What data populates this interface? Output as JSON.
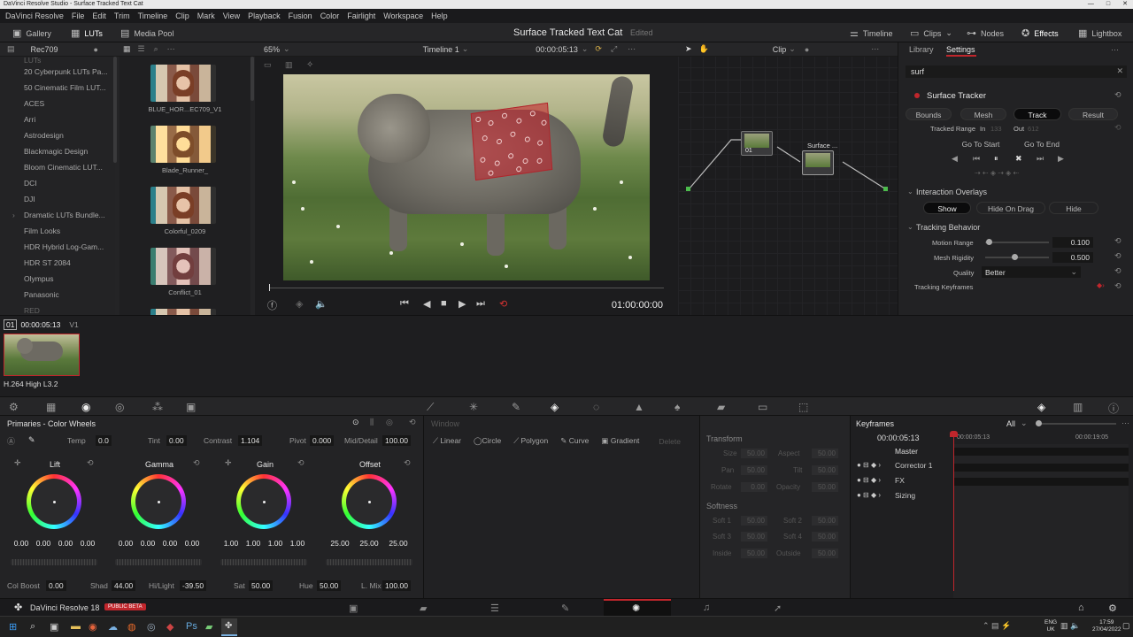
{
  "window_title": "DaVinci Resolve Studio - Surface Tracked Text Cat",
  "menu": [
    "DaVinci Resolve",
    "File",
    "Edit",
    "Trim",
    "Timeline",
    "Clip",
    "Mark",
    "View",
    "Playback",
    "Fusion",
    "Color",
    "Fairlight",
    "Workspace",
    "Help"
  ],
  "topbar": {
    "gallery": "Gallery",
    "luts": "LUTs",
    "media_pool": "Media Pool",
    "project": "Surface Tracked Text Cat",
    "edited": "Edited",
    "timeline": "Timeline",
    "clips": "Clips",
    "nodes": "Nodes",
    "effects": "Effects",
    "lightbox": "Lightbox"
  },
  "lut_browser": {
    "selector": "Rec709",
    "header": "LUTs",
    "items": [
      "20 Cyberpunk LUTs Pa...",
      "50 Cinematic Film LUT...",
      "ACES",
      "Arri",
      "Astrodesign",
      "Blackmagic Design",
      "Bloom Cinematic LUT...",
      "DCI",
      "DJI",
      "Dramatic LUTs Bundle...",
      "Film Looks",
      "HDR Hybrid Log-Gam...",
      "HDR ST 2084",
      "Olympus",
      "Panasonic",
      "RED"
    ],
    "thumbs": [
      "BLUE_HOR...EC709_V1",
      "Blade_Runner_",
      "Colorful_0209",
      "Conflict_01"
    ]
  },
  "viewer": {
    "zoom": "65%",
    "timeline": "Timeline 1",
    "timecode_top": "00:00:05:13",
    "timecode": "01:00:00:00",
    "mode": "Clip"
  },
  "nodes": {
    "node1_label": "01",
    "node2_label": "Surface ..."
  },
  "inspector": {
    "tab_library": "Library",
    "tab_settings": "Settings",
    "search": "surf",
    "effect": "Surface Tracker",
    "tabs": [
      "Bounds",
      "Mesh",
      "Track",
      "Result"
    ],
    "tracked_range": "Tracked Range",
    "in_label": "In",
    "in_val": "133",
    "out_label": "Out",
    "out_val": "612",
    "go_start": "Go To Start",
    "go_end": "Go To End",
    "interaction_overlays": "Interaction Overlays",
    "show": "Show",
    "hide_on_drag": "Hide On Drag",
    "hide": "Hide",
    "tracking_behavior": "Tracking Behavior",
    "motion_range_label": "Motion Range",
    "motion_range": "0.100",
    "mesh_rigidity_label": "Mesh Rigidity",
    "mesh_rigidity": "0.500",
    "quality_label": "Quality",
    "quality": "Better",
    "tracking_keyframes": "Tracking Keyframes"
  },
  "clip": {
    "index": "01",
    "tc": "00:00:05:13",
    "track": "V1",
    "codec": "H.264 High L3.2"
  },
  "color_wheels": {
    "title": "Primaries - Color Wheels",
    "temp_label": "Temp",
    "temp": "0.0",
    "tint_label": "Tint",
    "tint": "0.00",
    "contrast_label": "Contrast",
    "contrast": "1.104",
    "pivot_label": "Pivot",
    "pivot": "0.000",
    "middetail_label": "Mid/Detail",
    "middetail": "100.00",
    "wheels": [
      {
        "name": "Lift",
        "vals": [
          "0.00",
          "0.00",
          "0.00",
          "0.00"
        ]
      },
      {
        "name": "Gamma",
        "vals": [
          "0.00",
          "0.00",
          "0.00",
          "0.00"
        ]
      },
      {
        "name": "Gain",
        "vals": [
          "1.00",
          "1.00",
          "1.00",
          "1.00"
        ]
      },
      {
        "name": "Offset",
        "vals": [
          "25.00",
          "25.00",
          "25.00"
        ]
      }
    ],
    "colboost_label": "Col Boost",
    "colboost": "0.00",
    "shad_label": "Shad",
    "shad": "44.00",
    "hilight_label": "Hi/Light",
    "hilight": "-39.50",
    "sat_label": "Sat",
    "sat": "50.00",
    "hue_label": "Hue",
    "hue": "50.00",
    "lmix_label": "L. Mix",
    "lmix": "100.00"
  },
  "window_panel": {
    "title": "Window",
    "linear": "Linear",
    "circle": "Circle",
    "polygon": "Polygon",
    "curve": "Curve",
    "gradient": "Gradient",
    "delete": "Delete"
  },
  "transform": {
    "title": "Transform",
    "size_l": "Size",
    "size": "50.00",
    "aspect_l": "Aspect",
    "aspect": "50.00",
    "pan_l": "Pan",
    "pan": "50.00",
    "tilt_l": "Tilt",
    "tilt": "50.00",
    "rotate_l": "Rotate",
    "rotate": "0.00",
    "opacity_l": "Opacity",
    "opacity": "50.00",
    "softness": "Softness",
    "soft1_l": "Soft 1",
    "soft1": "50.00",
    "soft2_l": "Soft 2",
    "soft2": "50.00",
    "soft3_l": "Soft 3",
    "soft3": "50.00",
    "soft4_l": "Soft 4",
    "soft4": "50.00",
    "inside_l": "Inside",
    "inside": "50.00",
    "outside_l": "Outside",
    "outside": "50.00"
  },
  "keyframes": {
    "title": "Keyframes",
    "filter": "All",
    "tc": "00:00:05:13",
    "ruler1": "00:00:05:13",
    "ruler2": "00:00:19:05",
    "master": "Master",
    "rows": [
      "Corrector 1",
      "FX",
      "Sizing"
    ]
  },
  "pagebar": {
    "app": "DaVinci Resolve 18",
    "badge": "PUBLIC BETA"
  },
  "taskbar": {
    "lang1": "ENG",
    "lang2": "UK",
    "time": "17:59",
    "date": "27/04/2022"
  },
  "accent": "#c0262c"
}
